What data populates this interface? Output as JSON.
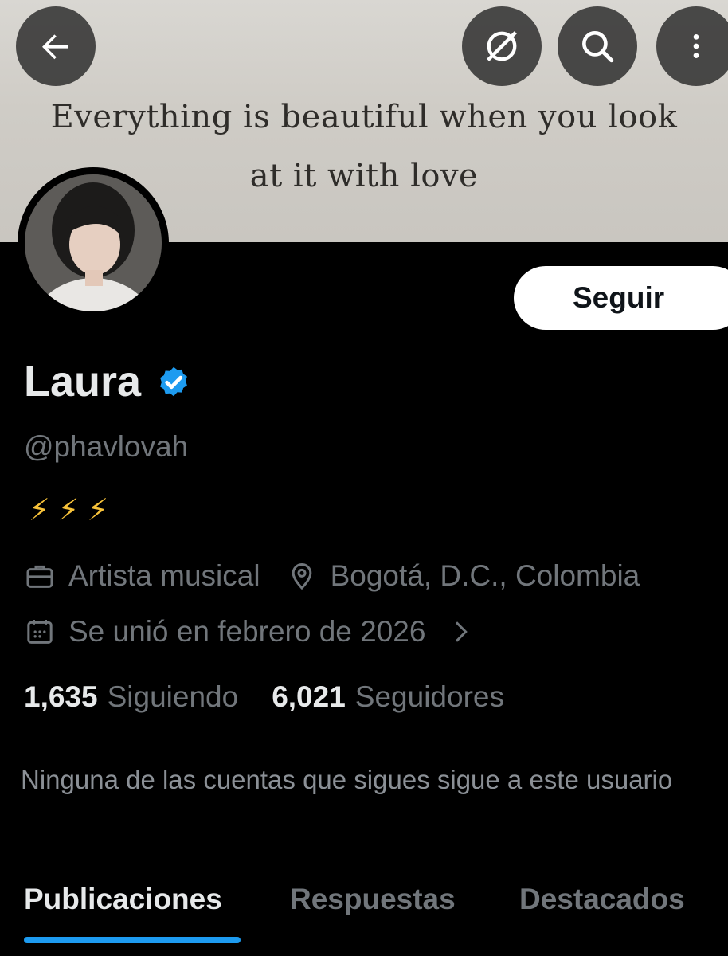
{
  "banner": {
    "line1": "Everything is beautiful when you look",
    "line2": "at it with love"
  },
  "header": {
    "back_icon": "arrow-left-icon",
    "translate_icon": "no-translate-icon",
    "search_icon": "search-icon",
    "more_icon": "more-vertical-icon"
  },
  "profile": {
    "follow_label": "Seguir",
    "display_name": "Laura",
    "verified_color": "#1d9bf0",
    "handle": "@phavlovah",
    "bio": "⚡⚡⚡",
    "category": "Artista musical",
    "location": "Bogotá, D.C., Colombia",
    "joined": "Se unió en febrero de 2026",
    "following_count": "1,635",
    "following_label": "Siguiendo",
    "followers_count": "6,021",
    "followers_label": "Seguidores",
    "mutuals_notice": "Ninguna de las cuentas que sigues sigue a este usuario"
  },
  "tabs": [
    {
      "label": "Publicaciones",
      "active": true
    },
    {
      "label": "Respuestas",
      "active": false
    },
    {
      "label": "Destacados",
      "active": false
    }
  ],
  "colors": {
    "accent": "#1d9bf0",
    "secondary_text": "#71767b",
    "background": "#000000"
  }
}
